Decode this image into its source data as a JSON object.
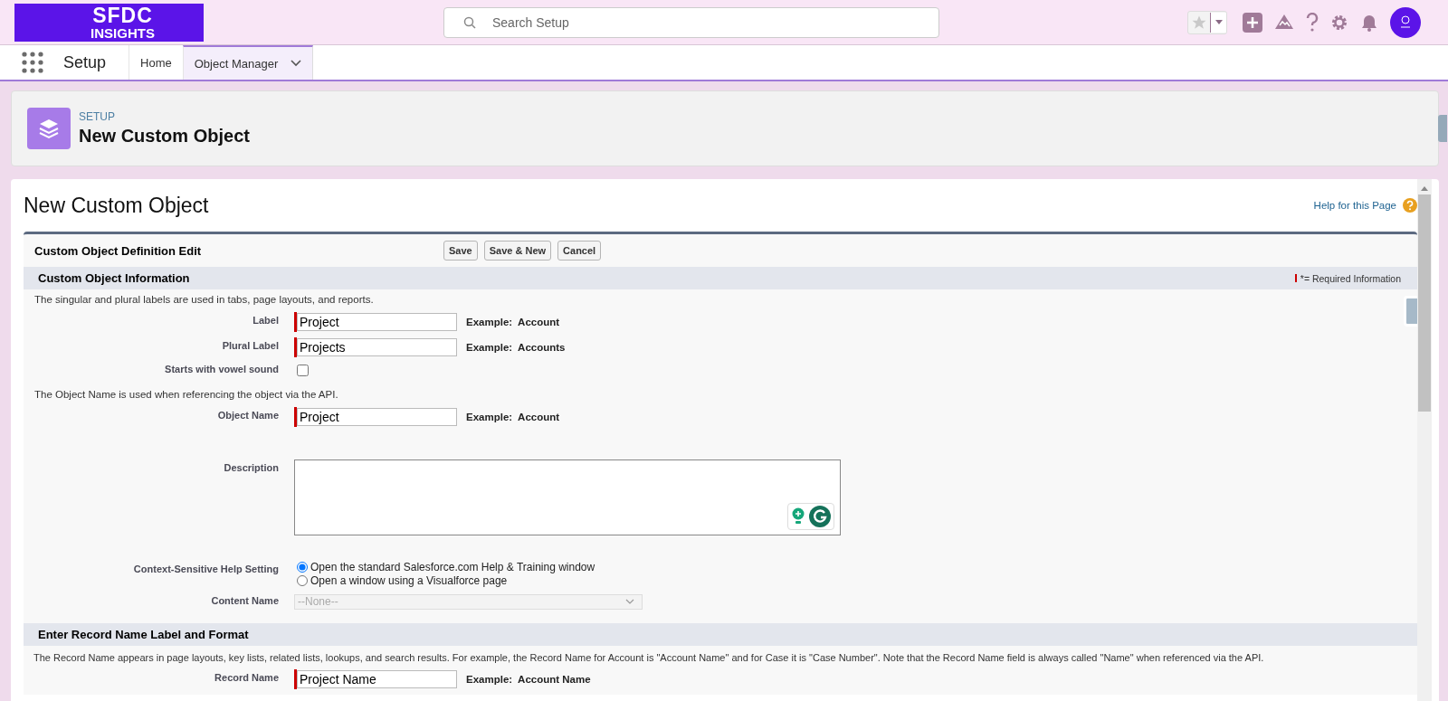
{
  "header": {
    "logo_line1": "SFDC",
    "logo_line2": "INSIGHTS",
    "search": {
      "placeholder": "Search Setup"
    }
  },
  "nav": {
    "app_name": "Setup",
    "tabs": [
      {
        "label": "Home",
        "selected": false,
        "dropdown": false
      },
      {
        "label": "Object Manager",
        "selected": true,
        "dropdown": true
      }
    ]
  },
  "page_header": {
    "eyebrow": "SETUP",
    "title": "New Custom Object"
  },
  "content": {
    "title": "New Custom Object",
    "help_link": "Help for this Page",
    "block_title": "Custom Object Definition Edit",
    "buttons": [
      "Save",
      "Save & New",
      "Cancel"
    ],
    "sections": [
      {
        "title": "Custom Object Information",
        "legend": "*= Required Information",
        "rows": [
          {
            "kind": "note",
            "text": "The singular and plural labels are used in tabs, page layouts, and reports."
          },
          {
            "kind": "text",
            "label": "Label",
            "value": "Project",
            "required": true,
            "example": "Example:  Account"
          },
          {
            "kind": "text",
            "label": "Plural Label",
            "value": "Projects",
            "required": true,
            "example": "Example:  Accounts"
          },
          {
            "kind": "checkbox",
            "label": "Starts with vowel sound",
            "checked": false
          },
          {
            "kind": "note",
            "text": "The Object Name is used when referencing the object via the API."
          },
          {
            "kind": "text",
            "label": "Object Name",
            "value": "Project",
            "required": true,
            "example": "Example:  Account"
          },
          {
            "kind": "textarea",
            "label": "Description",
            "value": ""
          },
          {
            "kind": "radio",
            "label": "Context-Sensitive Help Setting",
            "options": [
              {
                "label": "Open the standard Salesforce.com Help & Training window",
                "selected": true
              },
              {
                "label": "Open a window using a Visualforce page",
                "selected": false
              }
            ]
          },
          {
            "kind": "select",
            "label": "Content Name",
            "value": "--None--",
            "disabled": true
          }
        ]
      },
      {
        "title": "Enter Record Name Label and Format",
        "rows": [
          {
            "kind": "note",
            "text": "The Record Name appears in page layouts, key lists, related lists, lookups, and search results. For example, the Record Name for Account is \"Account Name\" and for Case it is \"Case Number\". Note that the Record Name field is always called \"Name\" when referenced via the API."
          },
          {
            "kind": "text",
            "label": "Record Name",
            "value": "Project Name",
            "required": true,
            "example": "Example:  Account Name"
          }
        ]
      }
    ]
  }
}
